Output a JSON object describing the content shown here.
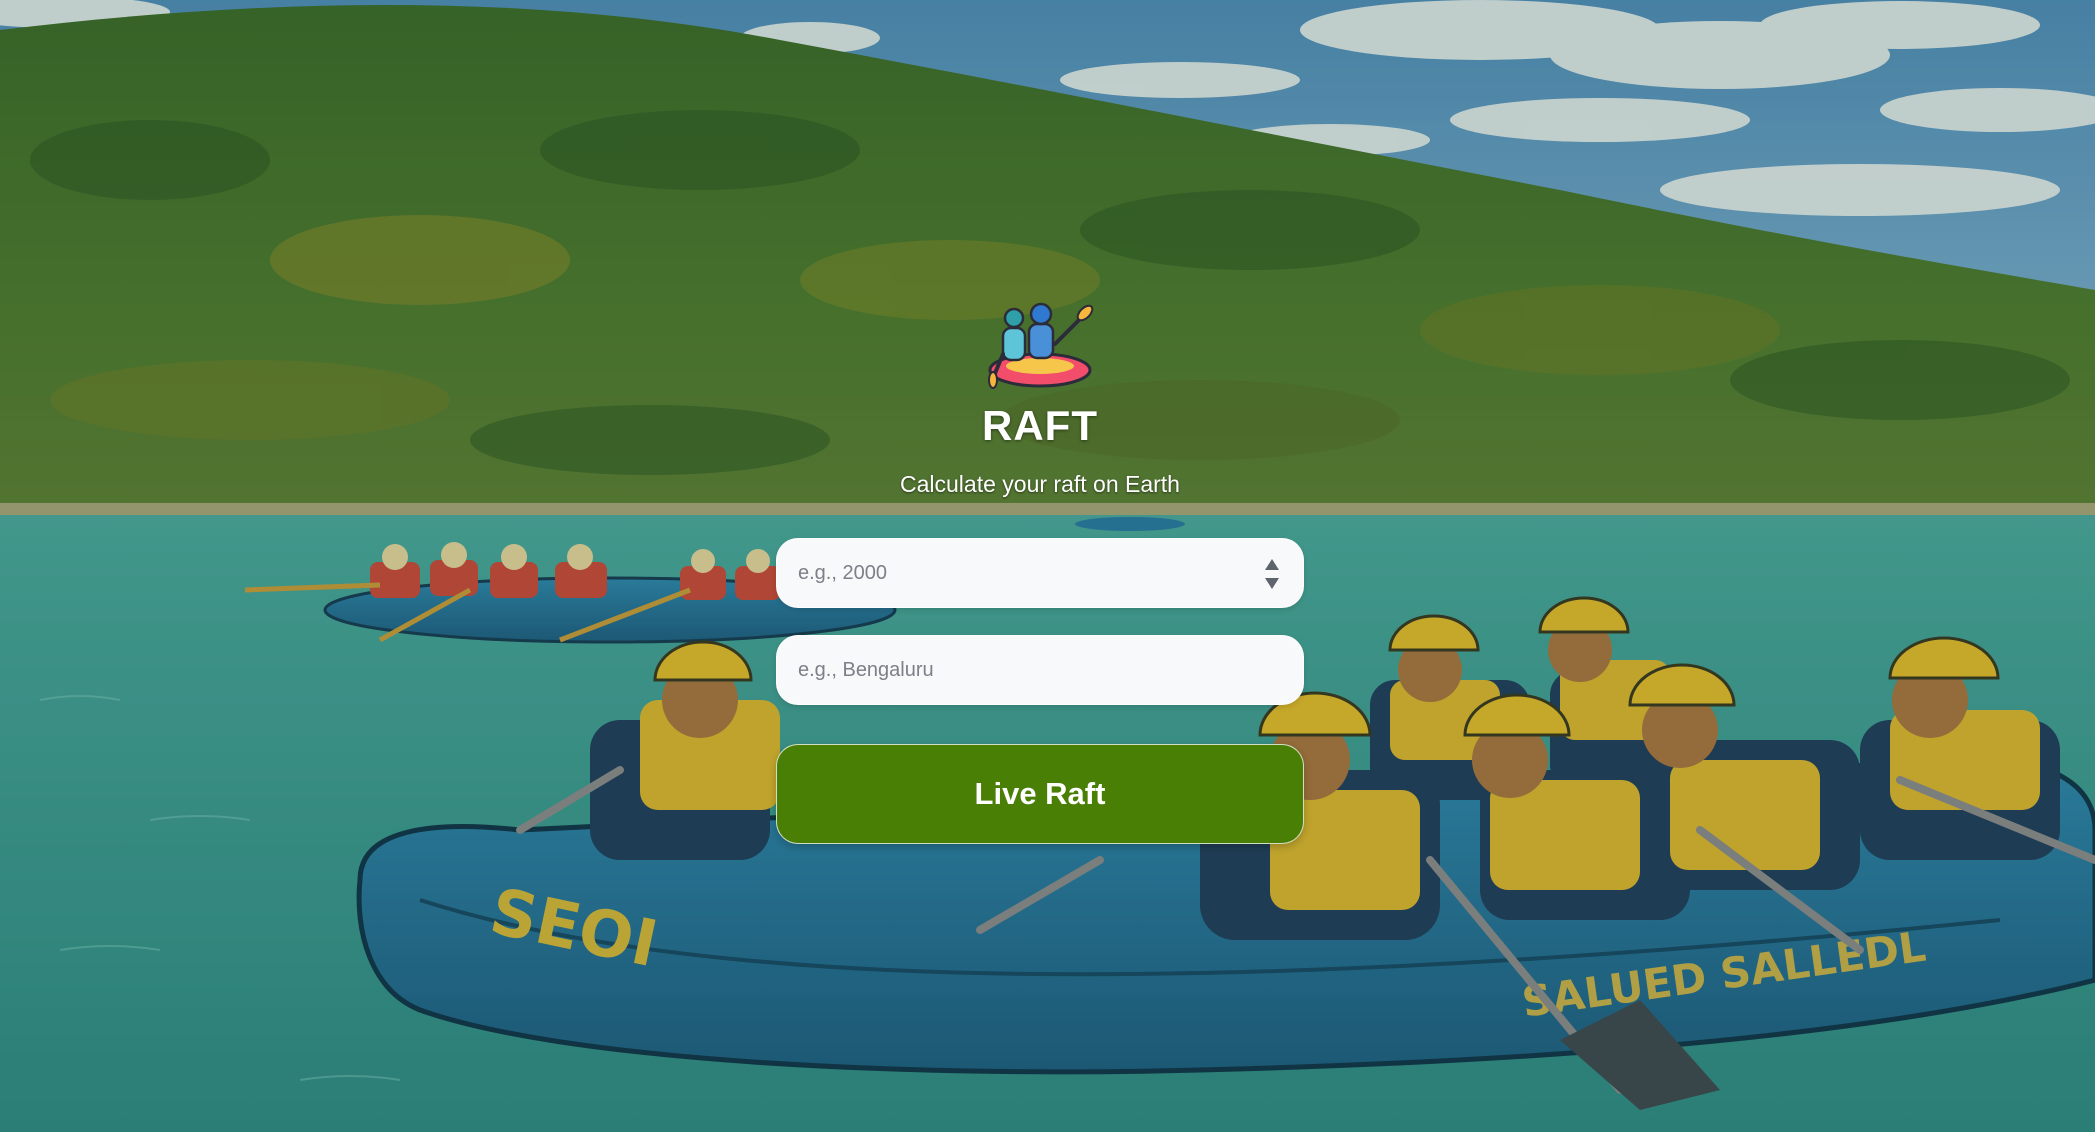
{
  "app": {
    "title": "RAFT",
    "subtitle": "Calculate your raft on Earth"
  },
  "form": {
    "year_placeholder": "e.g., 2000",
    "city_placeholder": "e.g., Bengaluru",
    "submit_label": "Live Raft"
  },
  "background": {
    "boat_text_left": "SEOI",
    "boat_text_right": "SALUED SALLEDL"
  },
  "icons": {
    "logo": "rafting-icon",
    "spinner_up": "chevron-up-icon",
    "spinner_down": "chevron-down-icon"
  },
  "colors": {
    "button": "#4a7f06",
    "water": "#3f9e92",
    "hill": "#3f6f2c",
    "sky": "#6fa6c6",
    "raft": "#2a7aa0"
  }
}
